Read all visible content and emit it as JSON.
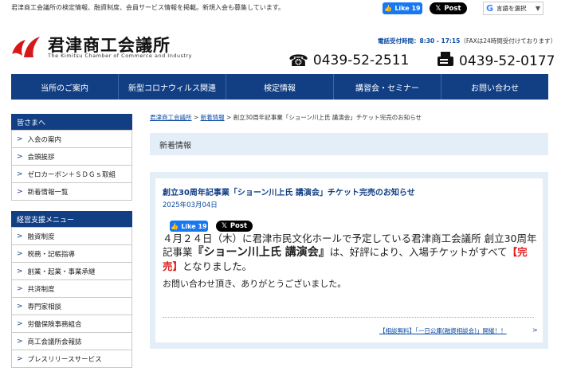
{
  "header": {
    "top_note": "君津商工会議所の検定情報、融資制度、会員サービス情報を掲載。新規入会も募集しています。",
    "fb_like": "Like 19",
    "x_post": "Post",
    "translate_label": "言語を選択",
    "logo_title": "君津商工会議所",
    "logo_subtitle": "The Kimitsu Chamber of Commerce and Industry",
    "hours_label": "電話受付時間：8:30 - 17:15",
    "hours_fax": "（FAXは24時間受付けております）",
    "tel": "0439-52-2511",
    "fax": "0439-52-0177"
  },
  "nav": {
    "items": [
      "当所のご案内",
      "新型コロナウィルス関連",
      "検定情報",
      "講習会・セミナー",
      "お問い合わせ"
    ]
  },
  "sidebar": {
    "section1": {
      "title": "皆さまへ",
      "items": [
        "入会の案内",
        "会頭挨拶",
        "ゼロカーボン＋ＳＤＧｓ取組",
        "新着情報一覧"
      ]
    },
    "section2": {
      "title": "経営支援メニュー",
      "items": [
        "融資制度",
        "税務・記帳指導",
        "創業・起業・事業承継",
        "共済制度",
        "専門家相談",
        "労働保険事務組合",
        "商工会議所会報誌",
        "プレスリリースサービス"
      ]
    }
  },
  "breadcrumb": {
    "home": "君津商工会議所",
    "sep": ">",
    "news": "新着情報",
    "current": "創立30周年記事業「ショーン川上氏 講演会」チケット完売のお知らせ"
  },
  "main": {
    "section_title": "新着情報",
    "article": {
      "title": "創立30周年記事業「ショーン川上氏 講演会」チケット完売のお知らせ",
      "date": "2025年03月04日",
      "fb_like": "Like 19",
      "x_post": "Post",
      "body_part1": "４月２４日（木）に君津市民文化ホールで予定している君津商工会議所 創立30周年記事業",
      "body_big": "『ショーン川上氏 講演会』",
      "body_part2": "は、好評により、入場チケットがすべて",
      "body_red": "【完売】",
      "body_part3": "となりました。",
      "body_thanks": "お問い合わせ頂き、ありがとうございました。"
    },
    "bottom_link": "【相談無料】「一日公庫(融資相談会)」開催！！",
    "bottom_link_arrow": ">"
  }
}
